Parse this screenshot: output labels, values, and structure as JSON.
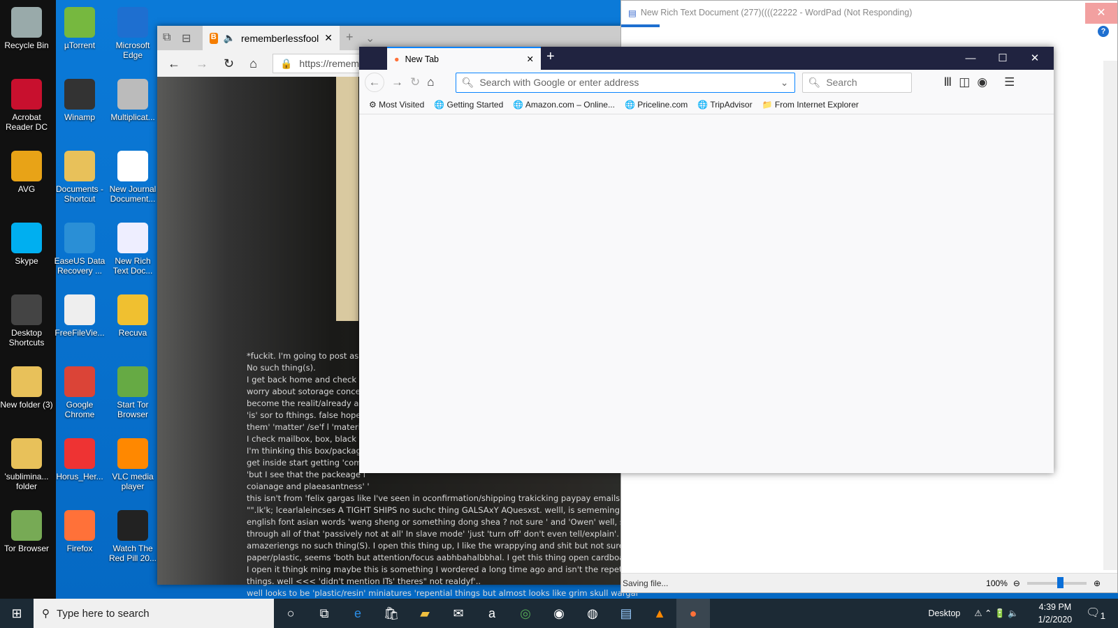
{
  "desktop": {
    "icons": [
      {
        "label": "Recycle Bin",
        "color": "#9aa"
      },
      {
        "label": "µTorrent",
        "color": "#76b83f"
      },
      {
        "label": "Microsoft Edge",
        "color": "#1e6fd0"
      },
      {
        "label": "Acrobat Reader DC",
        "color": "#c8102e"
      },
      {
        "label": "Winamp",
        "color": "#333"
      },
      {
        "label": "Multiplicat...",
        "color": "#bbb"
      },
      {
        "label": "AVG",
        "color": "#e8a317"
      },
      {
        "label": "Documents - Shortcut",
        "color": "#e8c15a"
      },
      {
        "label": "New Journal Document...",
        "color": "#fff"
      },
      {
        "label": "Skype",
        "color": "#00aff0"
      },
      {
        "label": "EaseUS Data Recovery ...",
        "color": "#2a8fd6"
      },
      {
        "label": "New Rich Text Doc...",
        "color": "#eef"
      },
      {
        "label": "Desktop Shortcuts",
        "color": "#444"
      },
      {
        "label": "FreeFileVie...",
        "color": "#eee"
      },
      {
        "label": "Recuva",
        "color": "#f0c030"
      },
      {
        "label": "New folder (3)",
        "color": "#e8c15a"
      },
      {
        "label": "Google Chrome",
        "color": "#db4437"
      },
      {
        "label": "Start Tor Browser",
        "color": "#6a4"
      },
      {
        "label": "'sublimina... folder",
        "color": "#e8c15a"
      },
      {
        "label": "Horus_Her...",
        "color": "#e33"
      },
      {
        "label": "VLC media player",
        "color": "#f80"
      },
      {
        "label": "Tor Browser",
        "color": "#7a5"
      },
      {
        "label": "Firefox",
        "color": "#ff7139"
      },
      {
        "label": "Watch The Red Pill 20...",
        "color": "#222"
      }
    ]
  },
  "edge": {
    "tab_title": "rememberlessfool",
    "url": "https://remem",
    "post_lines": [
      "*fuckit. I'm going to post as t",
      "No such thing(s).",
      "I get back home and check th",
      "worry about sotorage concer",
      "become the realit/already ar",
      "'is' sor to fthings. false hope l",
      "them' 'matter' /se'f l 'materia",
      "I check mailbox, box, black c",
      "I'm thinking this box/package",
      "get inside start getting 'comf",
      "'but I see that the packeage i",
      "coianage and plaeasantness' '",
      "this isn't from 'felix gargas like I've seen in oconfirmation/shipping trakicking paypay emails<(s).",
      "\"\".lk'k; lcearlaleincses A TIGHT SHIPS no suchc thing GALSAxY AQuesxst. welll, is sememing l y in",
      "english font asian words 'weng sheng or something dong shea ? not sure ' and 'Owen' well, sorting",
      "through all of that 'passively not at all' In slave mode' 'just 'turn off' don't even tell/explain'.",
      "amazeriengs no such thing(S). I open this thing up, I like the wrappying and shit but not sure, if",
      "paper/plastic, seems 'both but attention/focus aabhbahalbbhal. I get this thing open cardboard box,",
      "I open it thingk ming maybe this is something I wordered a long time ago and isn't the repetiass",
      "things. well <<< 'didn't mention ITs' theres\" not realdyf'..",
      "well looks to be 'plastic/resin' miniatures 'repential things but almost looks like grim skull wargame"
    ]
  },
  "wordpad": {
    "title": "New Rich Text Document (277)((((22222 - WordPad (Not Responding)",
    "status": "Saving file...",
    "zoom": "100%",
    "zoom_level": 0.55
  },
  "firefox": {
    "tab_title": "New Tab",
    "address_placeholder": "Search with Google or enter address",
    "search_placeholder": "Search",
    "bookmarks": [
      "Most Visited",
      "Getting Started",
      "Amazon.com – Online...",
      "Priceline.com",
      "TripAdvisor",
      "From Internet Explorer"
    ]
  },
  "taskbar": {
    "search_placeholder": "Type here to search",
    "desktop_label": "Desktop",
    "time": "4:39 PM",
    "date": "1/2/2020",
    "notifications": "1"
  }
}
